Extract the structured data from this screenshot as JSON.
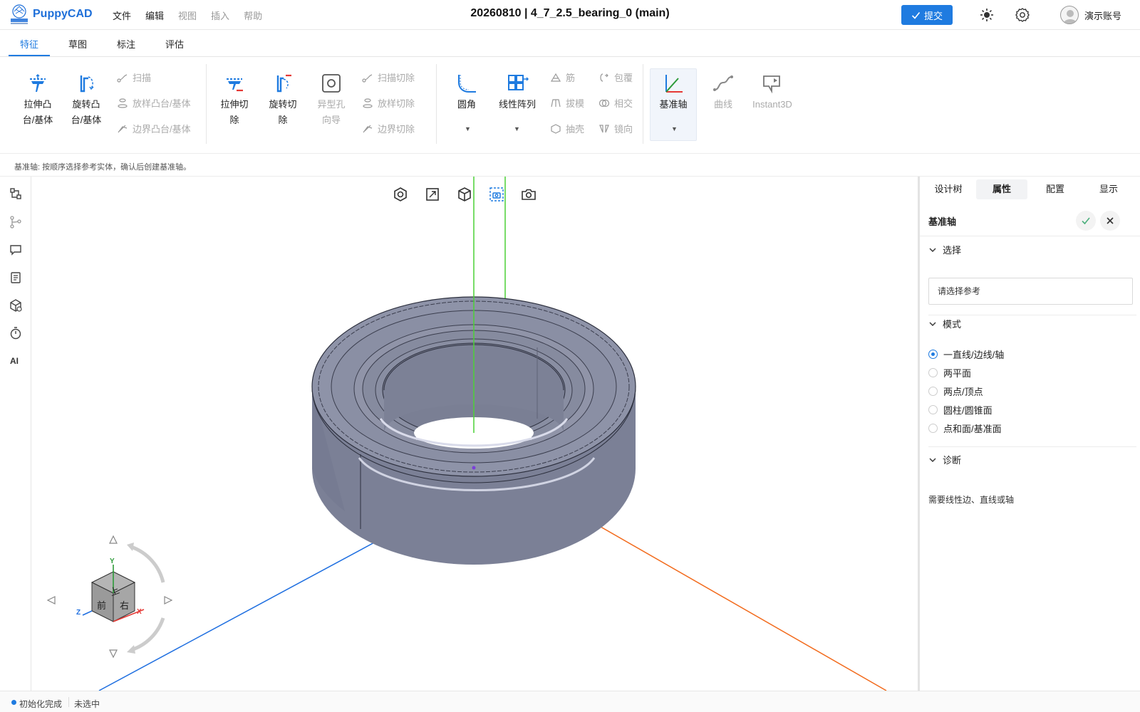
{
  "header": {
    "app_name": "PuppyCAD",
    "menu": [
      "文件",
      "编辑",
      "视图",
      "插入",
      "帮助"
    ],
    "doc_title": "20260810 | 4_7_2.5_bearing_0  (main)",
    "submit_label": "提交",
    "account_name": "演示账号"
  },
  "tabs": [
    "特征",
    "草图",
    "标注",
    "评估"
  ],
  "ribbon": {
    "extrude_boss": "拉伸凸台/基体",
    "revolve_boss": "旋转凸台/基体",
    "sweep": "扫描",
    "loft_boss": "放样凸台/基体",
    "boundary_boss": "边界凸台/基体",
    "extrude_cut": "拉伸切除",
    "revolve_cut": "旋转切除",
    "hole_wizard": "异型孔向导",
    "sweep_cut": "扫描切除",
    "loft_cut": "放样切除",
    "boundary_cut": "边界切除",
    "fillet": "圆角",
    "linear_pattern": "线性阵列",
    "rib": "筋",
    "draft": "拔模",
    "shell": "抽壳",
    "wrap": "包覆",
    "intersect": "相交",
    "mirror": "镜向",
    "ref_axis": "基准轴",
    "curve": "曲线",
    "instant3d": "Instant3D"
  },
  "hint": "基准轴: 按顺序选择参考实体，确认后创建基准轴。",
  "sidebar": {
    "ai_label": "AI"
  },
  "viewcube": {
    "top": "上",
    "front": "前",
    "right": "右",
    "axis_x": "X",
    "axis_y": "Y",
    "axis_z": "Z"
  },
  "panel": {
    "tabs": [
      "设计树",
      "属性",
      "配置",
      "显示"
    ],
    "title": "基准轴",
    "select_section": "选择",
    "select_placeholder": "请选择参考",
    "mode_section": "模式",
    "modes": [
      "一直线/边线/轴",
      "两平面",
      "两点/顶点",
      "圆柱/圆锥面",
      "点和面/基准面"
    ],
    "selected_mode": 0,
    "diag_section": "诊断",
    "diag_text": "需要线性边、直线或轴"
  },
  "status": {
    "state": "初始化完成",
    "selection": "未选中"
  },
  "colors": {
    "accent": "#1f7be0",
    "axis_x": "#f26b1d",
    "axis_y": "#4cd137",
    "axis_z": "#1f6fe0",
    "model": "#7b8096"
  }
}
